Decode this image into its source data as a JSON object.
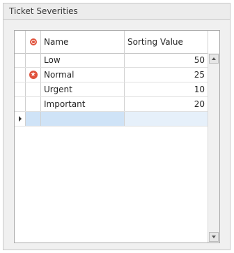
{
  "panel": {
    "title": "Ticket Severities"
  },
  "grid": {
    "columns": {
      "name": "Name",
      "sorting_value": "Sorting Value"
    },
    "rows": [
      {
        "name": "Low",
        "sorting_value": "50",
        "is_default": false
      },
      {
        "name": "Normal",
        "sorting_value": "25",
        "is_default": true
      },
      {
        "name": "Urgent",
        "sorting_value": "10",
        "is_default": false
      },
      {
        "name": "Important",
        "sorting_value": "20",
        "is_default": false
      }
    ]
  },
  "icons": {
    "default_header": "default-indicator-icon",
    "default_row": "default-star-icon",
    "new_row": "current-row-arrow-icon",
    "scroll_up": "chevron-up-icon",
    "scroll_down": "chevron-down-icon"
  },
  "colors": {
    "accent": "#e0523c",
    "new_row_highlight": "#cfe3f7"
  }
}
